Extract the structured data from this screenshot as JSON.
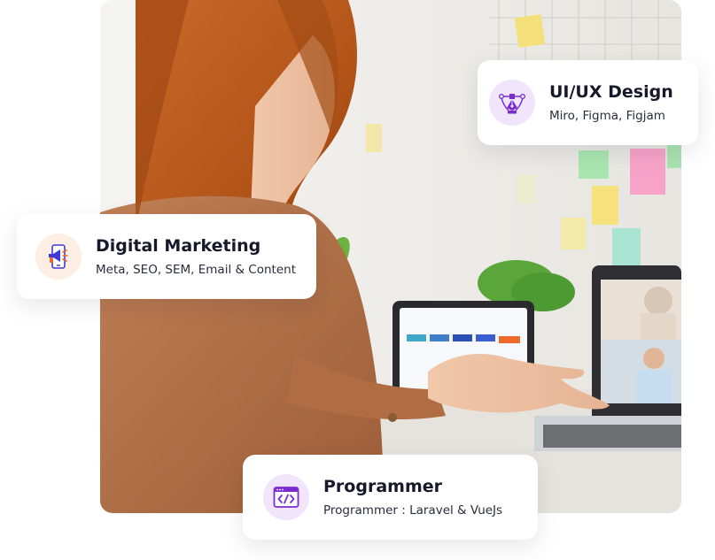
{
  "cards": {
    "uiux": {
      "title": "UI/UX Design",
      "subtitle": "Miro, Figma, Figjam",
      "icon": "pen-tool-icon"
    },
    "digital_marketing": {
      "title": "Digital Marketing",
      "subtitle": "Meta, SEO, SEM, Email & Content",
      "icon": "megaphone-icon"
    },
    "programmer": {
      "title": "Programmer",
      "subtitle": "Programmer :  Laravel & VueJs",
      "icon": "code-window-icon"
    }
  },
  "colors": {
    "card_title": "#16182c",
    "purple_accent": "#7b2ccf",
    "purple_badge_bg": "#f1e5fb",
    "orange_badge_bg": "#fdeee3"
  }
}
